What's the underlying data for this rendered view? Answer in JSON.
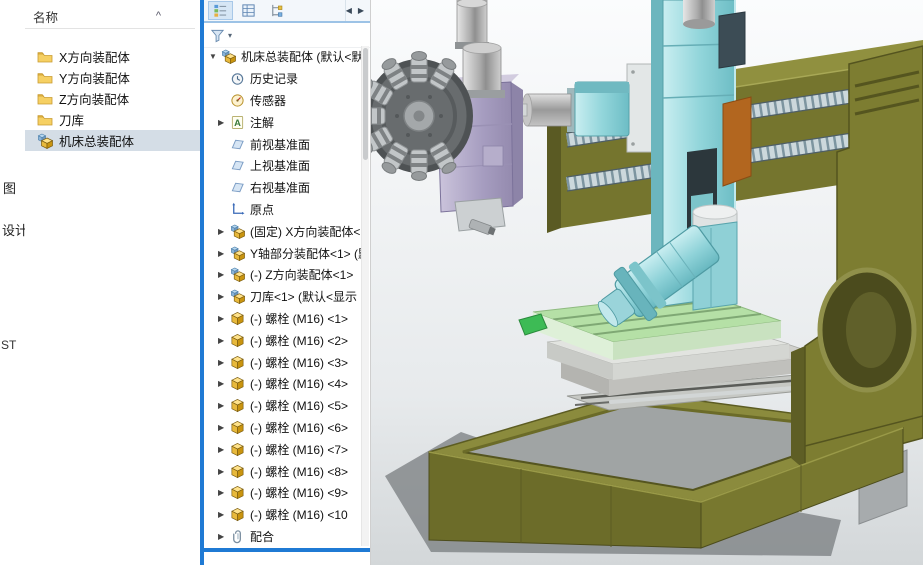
{
  "colors": {
    "machine_olive": "#7d7d31",
    "column_cyan": "#93d6db",
    "head_purple": "#b3abc9",
    "table_green": "#b5e0a6",
    "accent_blue": "#1f7ad4",
    "selection_bg": "#d4dde6"
  },
  "left_strip": {
    "fragments": [
      "图",
      "设计",
      "ST"
    ]
  },
  "file_panel": {
    "header": "名称",
    "collapse_glyph": "^",
    "items": [
      {
        "label": "X方向装配体",
        "icon": "folder-icon"
      },
      {
        "label": "Y方向装配体",
        "icon": "folder-icon"
      },
      {
        "label": "Z方向装配体",
        "icon": "folder-icon"
      },
      {
        "label": "刀库",
        "icon": "folder-icon"
      },
      {
        "label": "机床总装配体",
        "icon": "assembly-icon",
        "selected": true
      }
    ]
  },
  "tree_panel": {
    "tabs": [
      {
        "icon": "feature-manager-tab-icon"
      },
      {
        "icon": "property-manager-tab-icon"
      },
      {
        "icon": "configuration-manager-tab-icon"
      }
    ],
    "nav": {
      "back": "◀",
      "forward": "▶"
    },
    "filter": {
      "icon": "filter-icon",
      "caret": "▾"
    },
    "root": {
      "label": "机床总装配体 (默认<默认",
      "icon": "assembly-icon",
      "arrow": "▼"
    },
    "items": [
      {
        "label": "历史记录",
        "icon": "history-icon",
        "arrow": ""
      },
      {
        "label": "传感器",
        "icon": "sensor-icon",
        "arrow": ""
      },
      {
        "label": "注解",
        "icon": "annotation-icon",
        "arrow": "▶"
      },
      {
        "label": "前视基准面",
        "icon": "plane-icon",
        "arrow": ""
      },
      {
        "label": "上视基准面",
        "icon": "plane-icon",
        "arrow": ""
      },
      {
        "label": "右视基准面",
        "icon": "plane-icon",
        "arrow": ""
      },
      {
        "label": "原点",
        "icon": "origin-icon",
        "arrow": ""
      },
      {
        "label": "(固定) X方向装配体<",
        "icon": "assembly-icon",
        "arrow": "▶"
      },
      {
        "label": "Y轴部分装配体<1> (默",
        "icon": "assembly-icon",
        "arrow": "▶"
      },
      {
        "label": "(-) Z方向装配体<1>",
        "icon": "assembly-icon",
        "arrow": "▶"
      },
      {
        "label": "刀库<1> (默认<显示",
        "icon": "assembly-icon",
        "arrow": "▶"
      },
      {
        "label": "(-) 螺栓 (M16) <1>",
        "icon": "part-icon",
        "arrow": "▶"
      },
      {
        "label": "(-) 螺栓 (M16) <2>",
        "icon": "part-icon",
        "arrow": "▶"
      },
      {
        "label": "(-) 螺栓 (M16) <3>",
        "icon": "part-icon",
        "arrow": "▶"
      },
      {
        "label": "(-) 螺栓 (M16) <4>",
        "icon": "part-icon",
        "arrow": "▶"
      },
      {
        "label": "(-) 螺栓 (M16) <5>",
        "icon": "part-icon",
        "arrow": "▶"
      },
      {
        "label": "(-) 螺栓 (M16) <6>",
        "icon": "part-icon",
        "arrow": "▶"
      },
      {
        "label": "(-) 螺栓 (M16) <7>",
        "icon": "part-icon",
        "arrow": "▶"
      },
      {
        "label": "(-) 螺栓 (M16) <8>",
        "icon": "part-icon",
        "arrow": "▶"
      },
      {
        "label": "(-) 螺栓 (M16) <9>",
        "icon": "part-icon",
        "arrow": "▶"
      },
      {
        "label": "(-) 螺栓 (M16) <10",
        "icon": "part-icon",
        "arrow": "▶"
      },
      {
        "label": "配合",
        "icon": "mates-icon",
        "arrow": "▶"
      }
    ]
  }
}
